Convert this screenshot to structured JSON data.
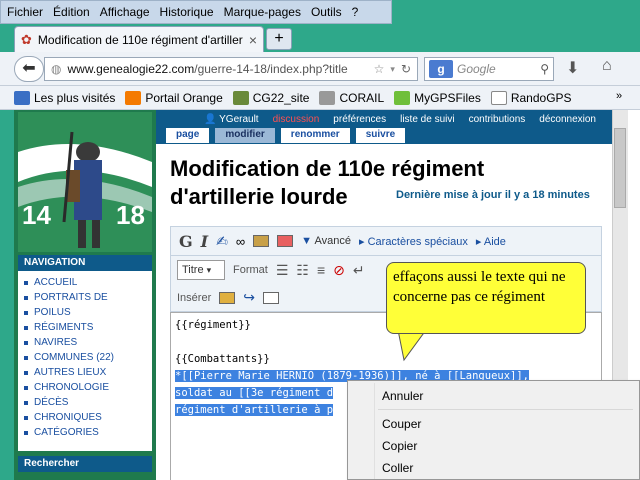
{
  "menu": [
    "Fichier",
    "Édition",
    "Affichage",
    "Historique",
    "Marque-pages",
    "Outils",
    "?"
  ],
  "tab": {
    "title": "Modification de 110e régiment d'artilleri...",
    "close": "×",
    "new": "+"
  },
  "url": {
    "host": "www.genealogie22.com",
    "path": "/guerre-14-18/index.php?title"
  },
  "search": {
    "placeholder": "Google",
    "engine": "g"
  },
  "bookmarks": [
    "Les plus visités",
    "Portail Orange",
    "CG22_site",
    "CORAIL",
    "MyGPSFiles",
    "RandoGPS"
  ],
  "logo": {
    "left": "14",
    "right": "18"
  },
  "user": {
    "name": "YGerault",
    "discussion": "discussion",
    "prefs": "préférences",
    "watchlist": "liste de suivi",
    "contribs": "contributions",
    "logout": "déconnexion"
  },
  "tabs": [
    "page",
    "modifier",
    "renommer",
    "suivre"
  ],
  "nav": {
    "heading": "NAVIGATION",
    "items": [
      "ACCUEIL",
      "PORTRAITS DE",
      "POILUS",
      "RÉGIMENTS",
      "NAVIRES",
      "COMMUNES (22)",
      "AUTRES LIEUX",
      "CHRONOLOGIE",
      "DÉCÈS",
      "CHRONIQUES",
      "CATÉGORIES"
    ],
    "search_heading": "Rechercher"
  },
  "page": {
    "title": "Modification de 110e régiment d'artillerie lourde",
    "updated": "Dernière mise à jour il y a 18 minutes"
  },
  "editor": {
    "advanced": "Avancé",
    "special": "Caractères spéciaux",
    "help": "Aide",
    "titre": "Titre",
    "format": "Format",
    "insert": "Insérer",
    "lines": [
      "{{régiment}}",
      "",
      "{{Combattants}}"
    ],
    "sel1": "*[[Pierre Marie HERNIO (1879-1936)]], né à [[Langueux]],",
    "sel2": "soldat au [[3e régiment d",
    "sel3": "régiment d'artillerie à p"
  },
  "callout": "effaçons aussi le texte qui ne concerne pas ce régiment",
  "context_menu": [
    "Annuler",
    "Couper",
    "Copier",
    "Coller"
  ]
}
